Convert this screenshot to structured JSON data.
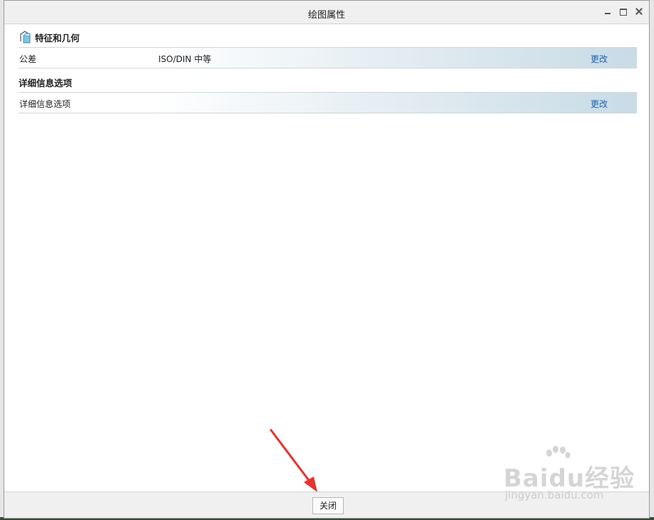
{
  "window": {
    "title": "绘图属性"
  },
  "sections": [
    {
      "header": "特征和几何",
      "icon": "feature-geometry-icon",
      "rows": [
        {
          "label": "公差",
          "value": "ISO/DIN 中等",
          "action": "更改"
        }
      ]
    },
    {
      "header": "详细信息选项",
      "rows": [
        {
          "label": "详细信息选项",
          "value": "",
          "action": "更改"
        }
      ]
    }
  ],
  "footer": {
    "close_label": "关闭"
  },
  "annotation": {
    "arrow_color": "#e8322d"
  },
  "watermark": {
    "brand": "Baidu经验",
    "url": "jingyan.baidu.com"
  },
  "colors": {
    "link": "#1b63b7",
    "row_gradient_end": "#c8dbe6"
  }
}
